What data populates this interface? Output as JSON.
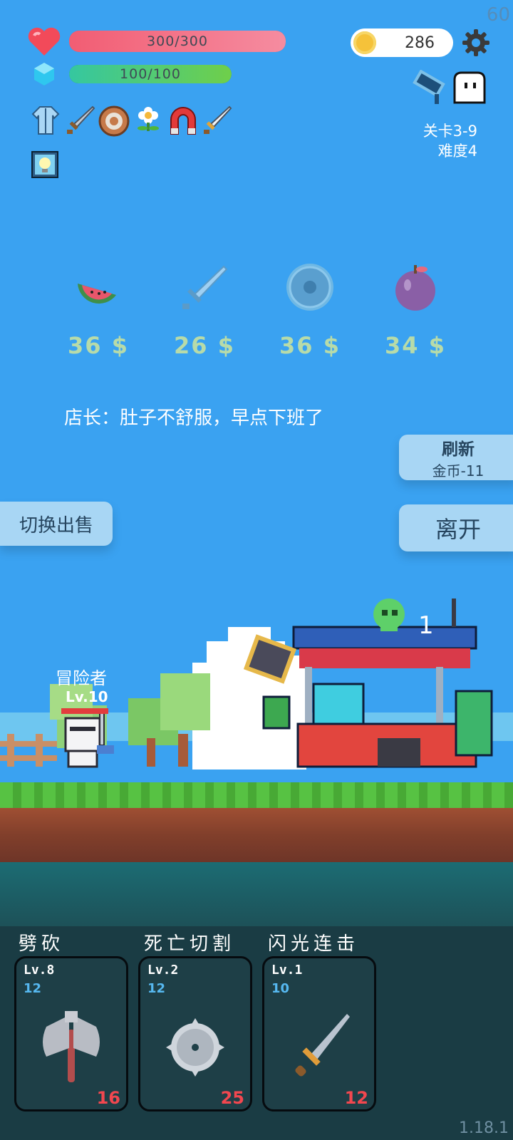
{
  "fps": "60",
  "version": "1.18.1",
  "hp": {
    "text": "300/300",
    "fraction": 1.0
  },
  "mp": {
    "text": "100/100",
    "fraction": 1.0
  },
  "gold": "286",
  "stage": {
    "level": "关卡3-9",
    "difficulty": "难度4"
  },
  "equipment_icons": [
    "robe-icon",
    "sword-icon",
    "shield-icon",
    "flower-icon",
    "magnet-icon",
    "sword-icon",
    "lightbulb-icon"
  ],
  "shop": {
    "items": [
      {
        "icon": "watermelon-icon",
        "price": "36 $"
      },
      {
        "icon": "sword-icon",
        "price": "26 $"
      },
      {
        "icon": "shield-icon",
        "price": "36 $"
      },
      {
        "icon": "apple-icon",
        "price": "34 $"
      }
    ],
    "dialog": "店长：肚子不舒服，早点下班了",
    "refresh_label": "刷新",
    "refresh_cost": "金币-11",
    "leave_label": "离开",
    "switch_sell_label": "切换出售"
  },
  "scene": {
    "adventurer_name": "冒险者",
    "adventurer_level": "Lv.10",
    "kill_count": "1"
  },
  "skills": [
    {
      "name": "劈砍",
      "level": "Lv.8",
      "cost": "12",
      "damage": "16",
      "icon": "axe-icon"
    },
    {
      "name": "死亡切割",
      "level": "Lv.2",
      "cost": "12",
      "damage": "25",
      "icon": "sawblade-icon"
    },
    {
      "name": "闪光连击",
      "level": "Lv.1",
      "cost": "10",
      "damage": "12",
      "icon": "sword-icon"
    }
  ],
  "colors": {
    "background": "#3aa2f1",
    "hp": "#f25d73",
    "mp": "#35c7a0",
    "price": "#b7dba9",
    "damage": "#f2474f"
  }
}
